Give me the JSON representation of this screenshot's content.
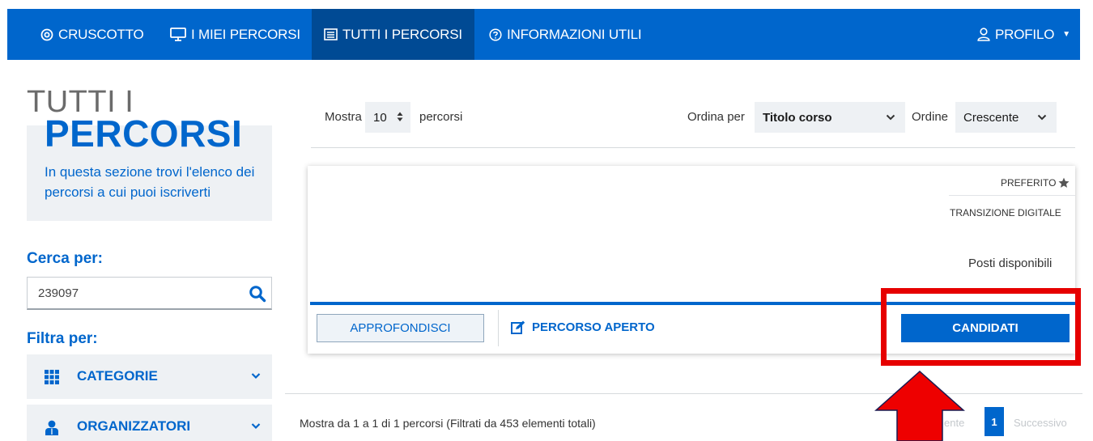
{
  "nav": {
    "items": [
      {
        "label": "CRUSCOTTO",
        "icon": "target-icon"
      },
      {
        "label": "I MIEI PERCORSI",
        "icon": "monitor-icon"
      },
      {
        "label": "TUTTI I PERCORSI",
        "icon": "list-icon",
        "active": true
      },
      {
        "label": "INFORMAZIONI UTILI",
        "icon": "help-circle-icon"
      }
    ],
    "profile_label": "PROFILO",
    "profile_icon": "user-icon"
  },
  "hero": {
    "line1": "TUTTI I",
    "line2": "PERCORSI",
    "description": "In questa sezione trovi l'elenco dei percorsi a cui puoi iscriverti"
  },
  "search": {
    "title": "Cerca per:",
    "value": "239097",
    "icon": "search-icon"
  },
  "filters": {
    "title": "Filtra per:",
    "items": [
      {
        "label": "CATEGORIE",
        "icon": "grid-icon"
      },
      {
        "label": "ORGANIZZATORI",
        "icon": "users-icon"
      }
    ]
  },
  "controls": {
    "show_label": "Mostra",
    "show_value": "10",
    "show_suffix": "percorsi",
    "sort_label": "Ordina per",
    "sort_value": "Titolo corso",
    "order_label": "Ordine",
    "order_value": "Crescente"
  },
  "card": {
    "favorite_label": "PREFERITO",
    "category": "TRANSIZIONE DIGITALE",
    "seats_label": "Posti disponibili",
    "details_button": "APPROFONDISCI",
    "status_label": "PERCORSO APERTO",
    "apply_button": "CANDIDATI"
  },
  "pagination": {
    "info": "Mostra da 1 a 1 di 1 percorsi (Filtrati da 453 elementi totali)",
    "prev_label": "ente",
    "current_page": "1",
    "next_label": "Successivo"
  },
  "colors": {
    "primary": "#0066cc",
    "primary_dark": "#004a94",
    "panel": "#eef1f4",
    "annotation": "#e60000"
  }
}
